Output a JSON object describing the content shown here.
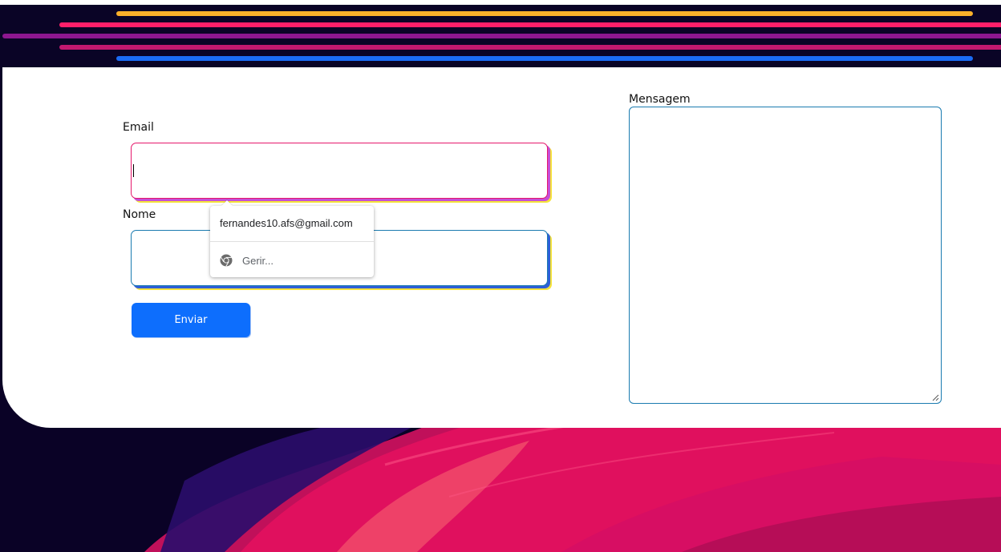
{
  "form": {
    "email_label": "Email",
    "email_value": "",
    "nome_label": "Nome",
    "nome_value": "",
    "mensagem_label": "Mensagem",
    "mensagem_value": "",
    "submit_label": "Enviar"
  },
  "autofill": {
    "suggestion": "fernandes10.afs@gmail.com",
    "manage_label": "Gerir..."
  },
  "colors": {
    "stripe_1": "#fbb02a",
    "stripe_2": "#ff1f6a",
    "stripe_3": "#8d178f",
    "stripe_4": "#c2186f",
    "stripe_5": "#1a6cf5",
    "button": "#0d6efd",
    "background_dark": "#0a0226"
  },
  "icons": {
    "manage": "chrome-icon"
  }
}
